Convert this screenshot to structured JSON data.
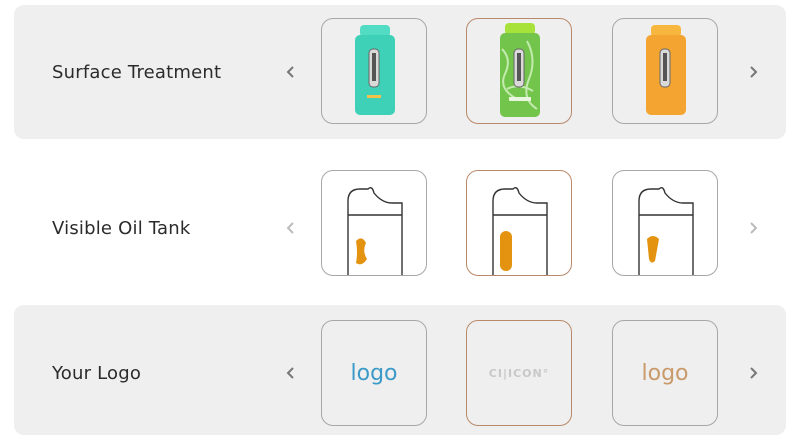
{
  "rows": [
    {
      "label": "Surface Treatment",
      "options": [
        {
          "name": "mint-matte-device"
        },
        {
          "name": "green-printed-device"
        },
        {
          "name": "orange-matte-device"
        }
      ]
    },
    {
      "label": "Visible Oil Tank",
      "options": [
        {
          "name": "curved-window-tank"
        },
        {
          "name": "tall-window-tank"
        },
        {
          "name": "short-window-tank"
        }
      ]
    },
    {
      "label": "Your Logo",
      "options": [
        {
          "text": "logo"
        },
        {
          "text": "CI|ICON°"
        },
        {
          "text": "logo"
        }
      ]
    }
  ],
  "colors": {
    "accent_orange": "#e3930f",
    "mint": "#3fd1b7",
    "lime": "#7fcf3a",
    "orange": "#f4a531",
    "logo_blue": "#3b9ac8",
    "logo_tan": "#c99a6a",
    "selected_border": "#b98a6a"
  }
}
